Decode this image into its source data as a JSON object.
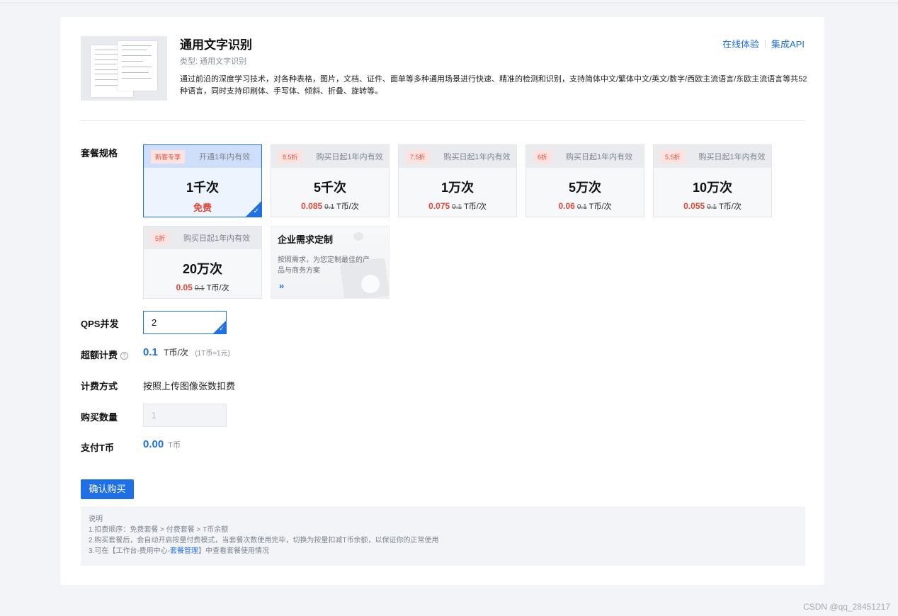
{
  "product": {
    "title": "通用文字识别",
    "type_label": "类型: 通用文字识别",
    "description": "通过前沿的深度学习技术，对各种表格，图片，文档、证件、面单等多种通用场景进行快速、精准的检测和识别，支持简体中文/繁体中文/英文/数字/西欧主流语言/东欧主流语言等共52种语言，同时支持印刷体、手写体、倾斜、折叠、旋转等。"
  },
  "header_links": {
    "try_online": "在线体验",
    "integrate_api": "集成API"
  },
  "labels": {
    "package": "套餐规格",
    "qps": "QPS并发",
    "overage": "超额计费",
    "billing_method": "计费方式",
    "quantity": "购买数量",
    "pay": "支付T币"
  },
  "packages": [
    {
      "badge": "新客专享",
      "validity": "开通1年内有效",
      "name": "1千次",
      "price_now": "免费",
      "price_old": "",
      "unit": "",
      "selected": true
    },
    {
      "badge": "8.5折",
      "validity": "购买日起1年内有效",
      "name": "5千次",
      "price_now": "0.085",
      "price_old": "0.1",
      "unit": "T币/次",
      "selected": false
    },
    {
      "badge": "7.5折",
      "validity": "购买日起1年内有效",
      "name": "1万次",
      "price_now": "0.075",
      "price_old": "0.1",
      "unit": "T币/次",
      "selected": false
    },
    {
      "badge": "6折",
      "validity": "购买日起1年内有效",
      "name": "5万次",
      "price_now": "0.06",
      "price_old": "0.1",
      "unit": "T币/次",
      "selected": false
    },
    {
      "badge": "5.5折",
      "validity": "购买日起1年内有效",
      "name": "10万次",
      "price_now": "0.055",
      "price_old": "0.1",
      "unit": "T币/次",
      "selected": false
    },
    {
      "badge": "5折",
      "validity": "购买日起1年内有效",
      "name": "20万次",
      "price_now": "0.05",
      "price_old": "0.1",
      "unit": "T币/次",
      "selected": false
    }
  ],
  "enterprise": {
    "title": "企业需求定制",
    "desc": "按照需求，为您定制最佳的产品与商务方案",
    "arrow": "»"
  },
  "qps": {
    "value": "2"
  },
  "overage": {
    "price": "0.1",
    "unit": "T币/次",
    "note": "(1T币=1元)"
  },
  "billing_method": {
    "value": "按照上传图像张数扣费"
  },
  "quantity": {
    "value": "1"
  },
  "pay": {
    "amount": "0.00",
    "unit": "T币"
  },
  "buy_button": "确认购买",
  "notes": {
    "title": "说明",
    "line1": "1.扣费顺序：免费套餐 > 付费套餐 > T币余额",
    "line2": "2.购买套餐后，会自动开启按量付费模式，当套餐次数使用完毕，切换为按量扣减T币余额，以保证你的正常使用",
    "line3_pre": "3.可在【工作台-费用中心-",
    "line3_link": "套餐管理",
    "line3_post": "】中查看套餐使用情况"
  },
  "watermark": "CSDN @qq_28451217",
  "colors": {
    "accent": "#1f6fe5",
    "discount_red": "#e64736"
  }
}
